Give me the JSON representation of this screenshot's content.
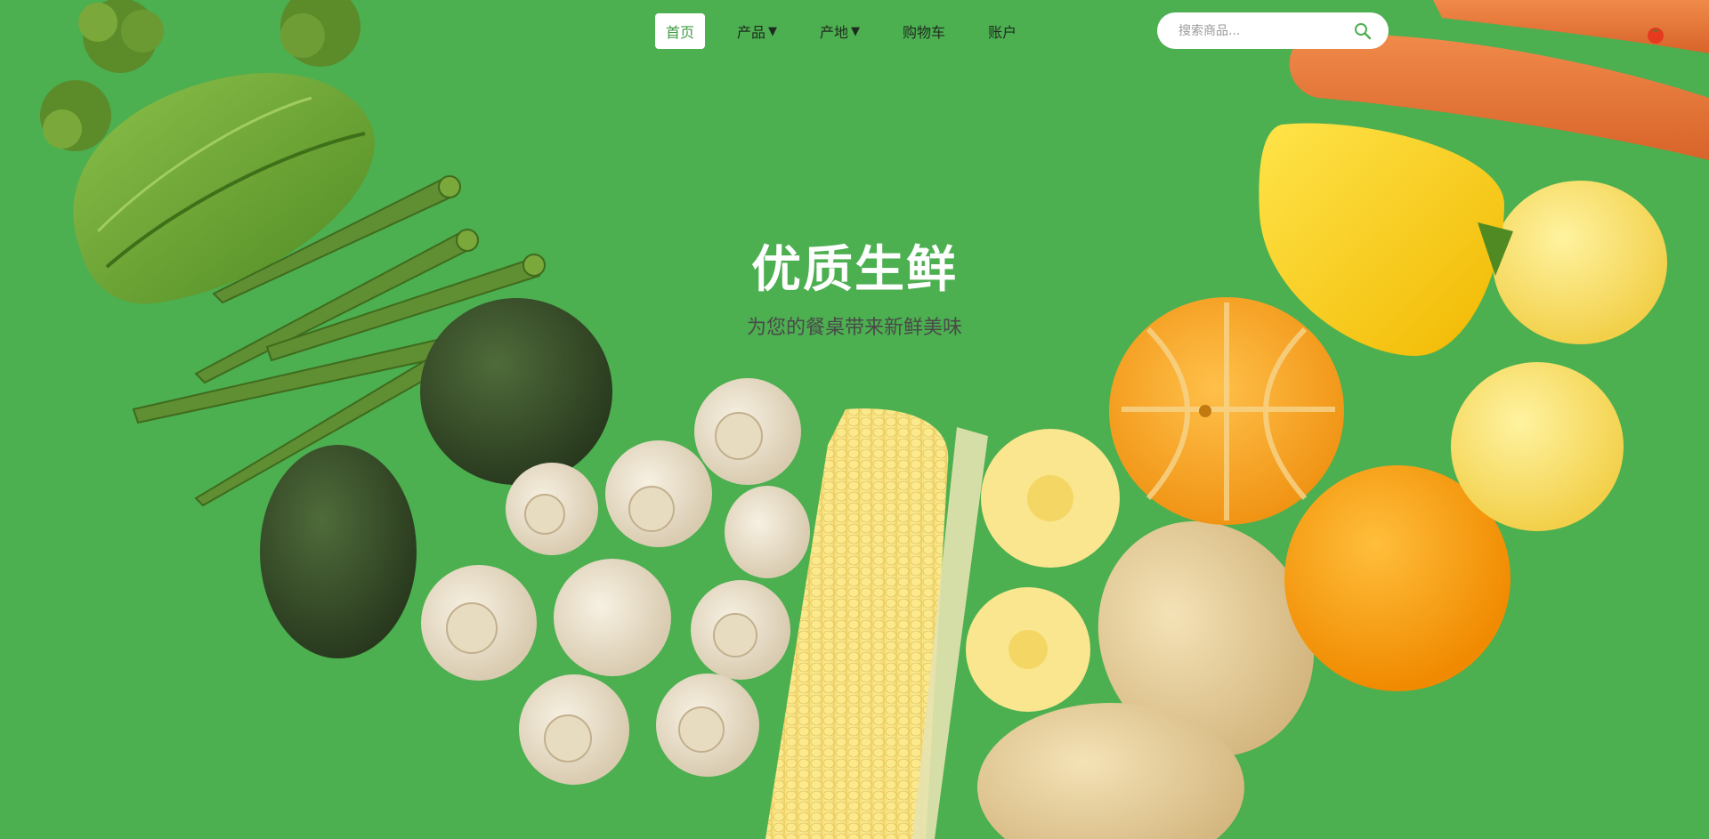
{
  "nav": {
    "items": [
      {
        "label": "首页",
        "active": true,
        "dropdown": false
      },
      {
        "label": "产品",
        "active": false,
        "dropdown": true
      },
      {
        "label": "产地",
        "active": false,
        "dropdown": true
      },
      {
        "label": "购物车",
        "active": false,
        "dropdown": false
      },
      {
        "label": "账户",
        "active": false,
        "dropdown": false
      }
    ],
    "dropdown_glyph": "▼"
  },
  "search": {
    "placeholder": "搜索商品...",
    "value": "",
    "icon": "search-icon"
  },
  "cart": {
    "icon": "tomato-icon"
  },
  "hero": {
    "title": "优质生鲜",
    "subtitle": "为您的餐桌带来新鲜美味"
  },
  "colors": {
    "background": "#4caf50",
    "accent": "#3f9c45",
    "title": "#ffffff",
    "subtitle": "#4a4a4a"
  }
}
